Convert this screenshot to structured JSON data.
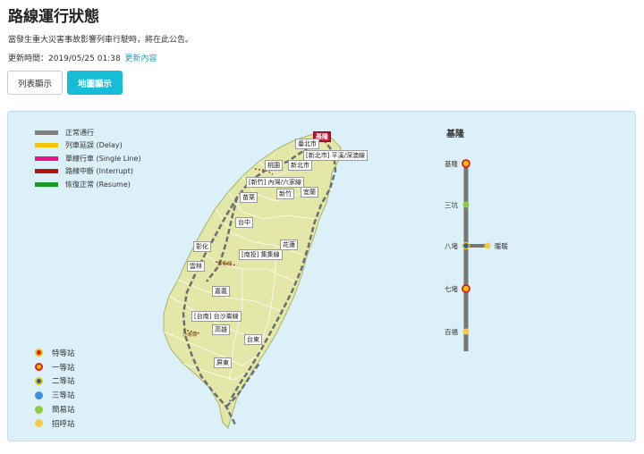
{
  "page": {
    "title": "路線運行狀態",
    "notice": "當發生重大災害事故影響列車行駛時，將在此公告。",
    "updated_prefix": "更新時間：2019/05/25 01:38",
    "updated_link": "更新內容"
  },
  "buttons": {
    "list_view": "列表顯示",
    "map_view": "地圖顯示"
  },
  "legend": [
    {
      "label": "正常通行",
      "color": "#808080"
    },
    {
      "label": "列車延誤 (Delay)",
      "color": "#f2c500"
    },
    {
      "label": "單線行車 (Single Line)",
      "color": "#e8168a"
    },
    {
      "label": "路線中斷 (Interrupt)",
      "color": "#b3140f"
    },
    {
      "label": "恢復正常 (Resume)",
      "color": "#1a9a2a"
    }
  ],
  "station_legend": [
    {
      "label": "特等站",
      "fill": "#d81e1e",
      "border": "#f2c500"
    },
    {
      "label": "一等站",
      "fill": "#f2c500",
      "border": "#d81e1e"
    },
    {
      "label": "二等站",
      "fill": "#1f5fb0",
      "border": "#f2c500"
    },
    {
      "label": "三等站",
      "fill": "#3d8fe0",
      "border": "#3d8fe0"
    },
    {
      "label": "簡易站",
      "fill": "#8fcf3c",
      "border": "#8fcf3c"
    },
    {
      "label": "招呼站",
      "fill": "#f7c842",
      "border": "#f7c842"
    }
  ],
  "line_detail": {
    "title": "基隆",
    "stations": [
      "基隆",
      "三坑",
      "八堵",
      "暖暖",
      "七堵",
      "百福"
    ]
  },
  "map_labels": {
    "keelung": "基隆",
    "taipei": "臺北市",
    "newtaipei1": "[新北市] 平溪/深澳線",
    "taoyuan": "桃園",
    "newtaipei2": "新北市",
    "hsinchu_branch": "[新竹] 內灣/六家線",
    "hsinchu": "新竹",
    "yilan": "宜蘭",
    "miaoli": "苗栗",
    "taichung": "台中",
    "hualien": "花蓮",
    "changhua": "彰化",
    "nantou": "[南投] 集集線",
    "jiji": "集集線",
    "yunlin": "雲林",
    "chiayi": "嘉義",
    "tainan": "[台南] 台沙崙線",
    "shalun": "沙崙線",
    "kaohsiung": "高雄",
    "taitung": "台東",
    "pingtung": "屏東"
  },
  "colors": {
    "accent": "#17bcd7",
    "island": "#e3e8a8",
    "sea": "#dbf0f8",
    "track": "#6e6e6e"
  }
}
